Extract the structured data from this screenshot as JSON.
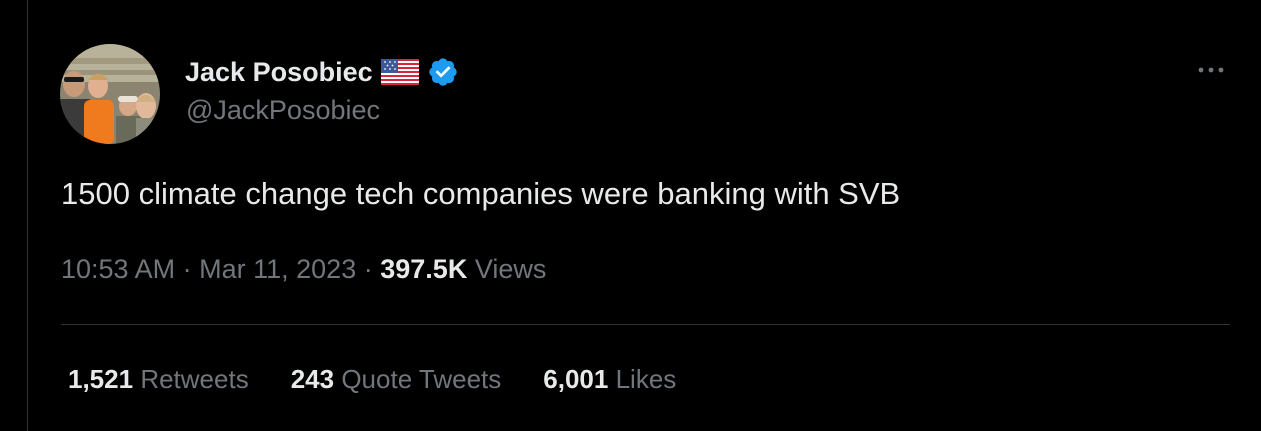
{
  "colors": {
    "background": "#000000",
    "text_primary": "#e7e9ea",
    "text_secondary": "#71767b",
    "divider": "#2f3336",
    "verified_blue": "#1d9bf0"
  },
  "author": {
    "display_name": "Jack Posobiec",
    "handle": "@JackPosobiec",
    "badges": [
      "us-flag-icon",
      "verified-badge-icon"
    ]
  },
  "tweet": {
    "text": "1500 climate change tech companies were banking with SVB",
    "time": "10:53 AM",
    "date": "Mar 11, 2023",
    "separator": "·",
    "views_count": "397.5K",
    "views_label": "Views"
  },
  "stats": {
    "retweets_count": "1,521",
    "retweets_label": "Retweets",
    "quotes_count": "243",
    "quotes_label": "Quote Tweets",
    "likes_count": "6,001",
    "likes_label": "Likes"
  }
}
